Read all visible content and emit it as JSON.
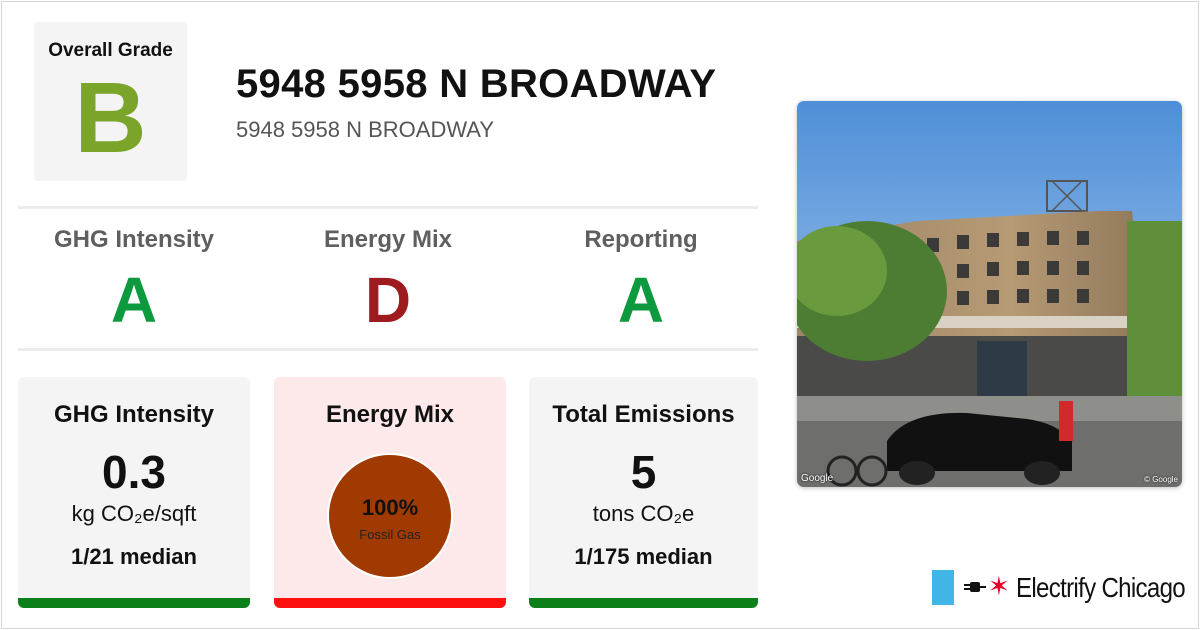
{
  "overall": {
    "label": "Overall Grade",
    "grade": "B",
    "color": "#7aa52a"
  },
  "building": {
    "name": "5948 5958 N BROADWAY",
    "address": "5948 5958 N BROADWAY"
  },
  "grades": [
    {
      "label": "GHG Intensity",
      "grade": "A",
      "color": "#0d9a3e"
    },
    {
      "label": "Energy Mix",
      "grade": "D",
      "color": "#9e1c20"
    },
    {
      "label": "Reporting",
      "grade": "A",
      "color": "#0d9a3e"
    }
  ],
  "cards": {
    "ghg": {
      "title": "GHG Intensity",
      "value": "0.3",
      "unit": "kg CO₂e/sqft",
      "median": "1/21 median",
      "bar_color": "#0a7f1a"
    },
    "mix": {
      "title": "Energy Mix",
      "percent": "100%",
      "fuel": "Fossil Gas",
      "fossil_gas_share": 1.0,
      "circle_color": "#a13a00",
      "bar_color": "#ff1010",
      "bg_color": "#fde9ea"
    },
    "emissions": {
      "title": "Total Emissions",
      "value": "5",
      "unit": "tons CO₂e",
      "median": "1/175 median",
      "bar_color": "#0a7f1a"
    }
  },
  "photo": {
    "credit_left": "Google",
    "credit_right": "© Google"
  },
  "brand": {
    "text": "Electrify Chicago",
    "star": "✶",
    "flag_color": "#41b6e6",
    "star_color": "#e4002b"
  }
}
